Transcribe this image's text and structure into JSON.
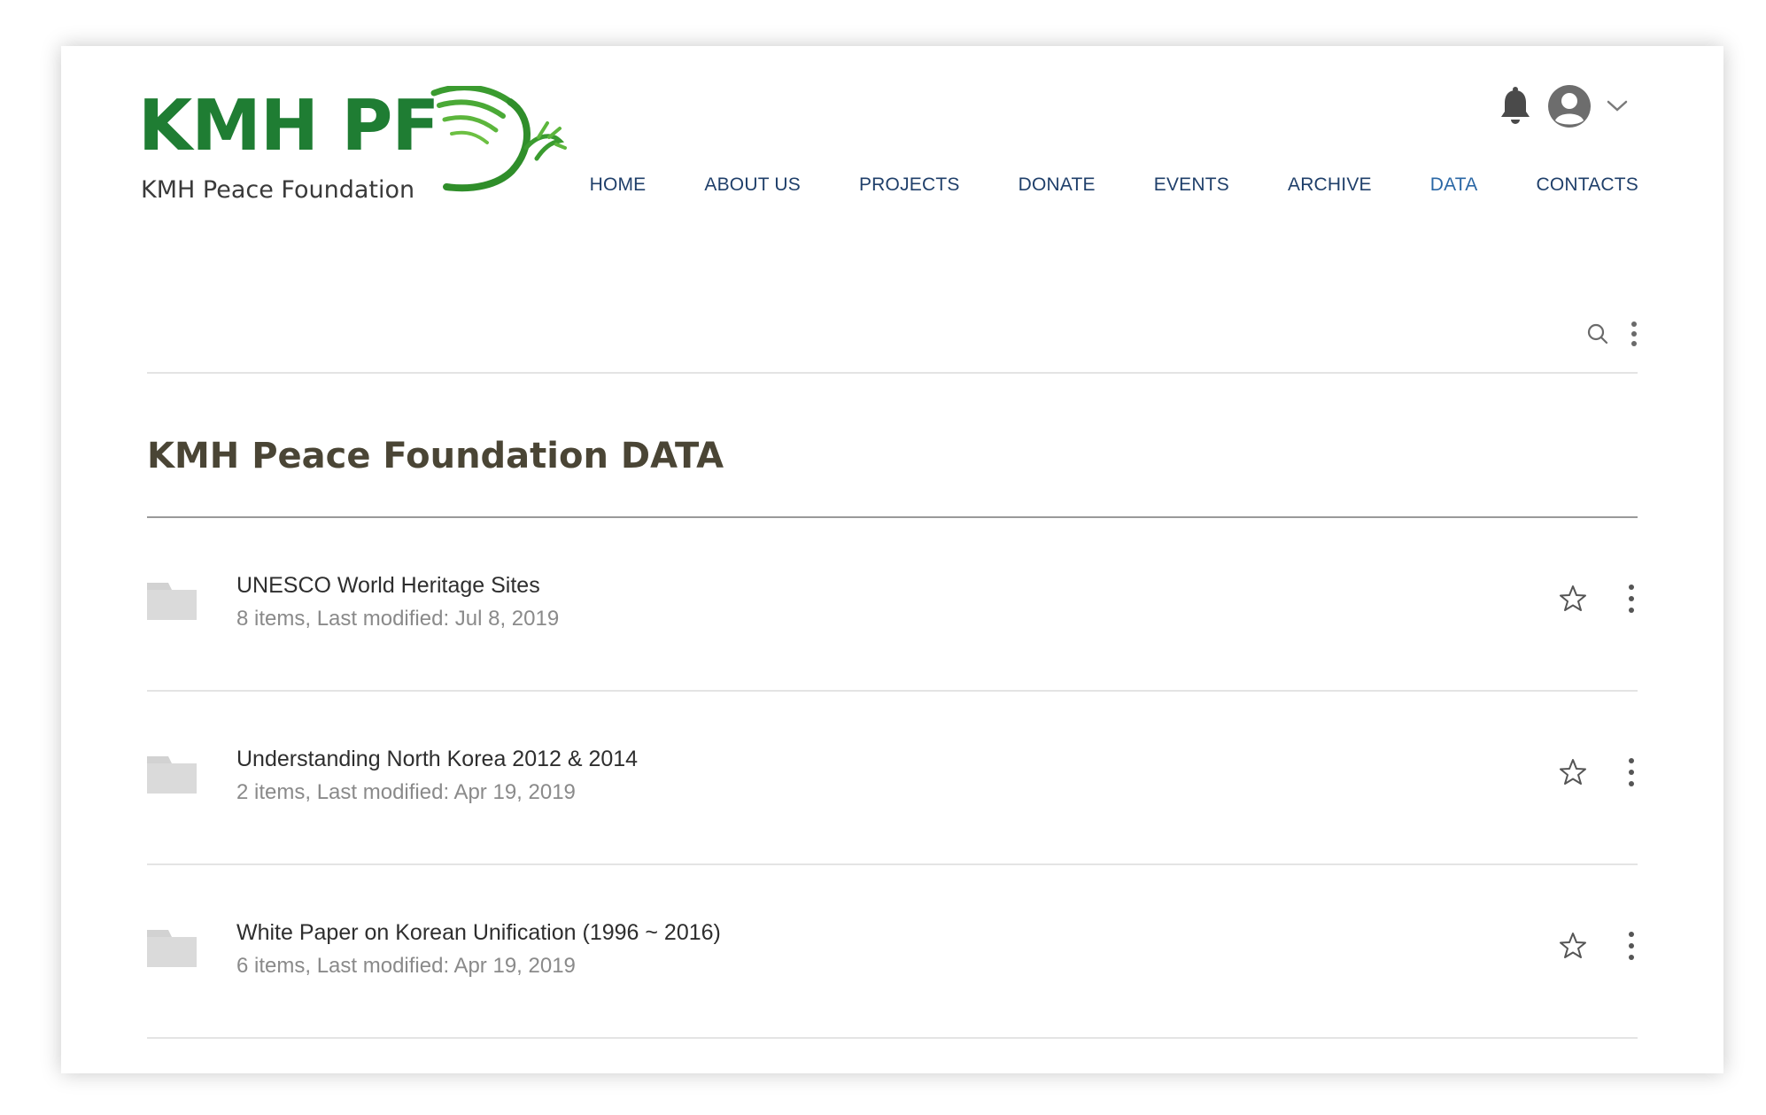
{
  "brand": {
    "logo_text": "KMH PF",
    "logo_subtitle": "KMH Peace Foundation",
    "colors": {
      "green": "#1f7d33",
      "nav_text": "#1f3f6a",
      "nav_active": "#2a67a5"
    }
  },
  "header": {
    "icons": [
      "bell-icon",
      "avatar-icon",
      "chevron-down-icon"
    ]
  },
  "nav": {
    "items": [
      {
        "label": "HOME"
      },
      {
        "label": "ABOUT US"
      },
      {
        "label": "PROJECTS"
      },
      {
        "label": "DONATE"
      },
      {
        "label": "EVENTS"
      },
      {
        "label": "ARCHIVE"
      },
      {
        "label": "DATA",
        "active": true
      },
      {
        "label": "CONTACTS"
      }
    ]
  },
  "toolbar": {
    "icons": [
      "search-icon",
      "more-vertical-icon"
    ]
  },
  "page": {
    "title": "KMH Peace Foundation DATA"
  },
  "folders": [
    {
      "name": "UNESCO World Heritage Sites",
      "meta": "8 items, Last modified: Jul 8, 2019"
    },
    {
      "name": "Understanding North Korea 2012 & 2014",
      "meta": "2 items, Last modified: Apr 19, 2019"
    },
    {
      "name": "White Paper on Korean Unification (1996 ~ 2016)",
      "meta": "6 items, Last modified: Apr 19, 2019"
    }
  ]
}
